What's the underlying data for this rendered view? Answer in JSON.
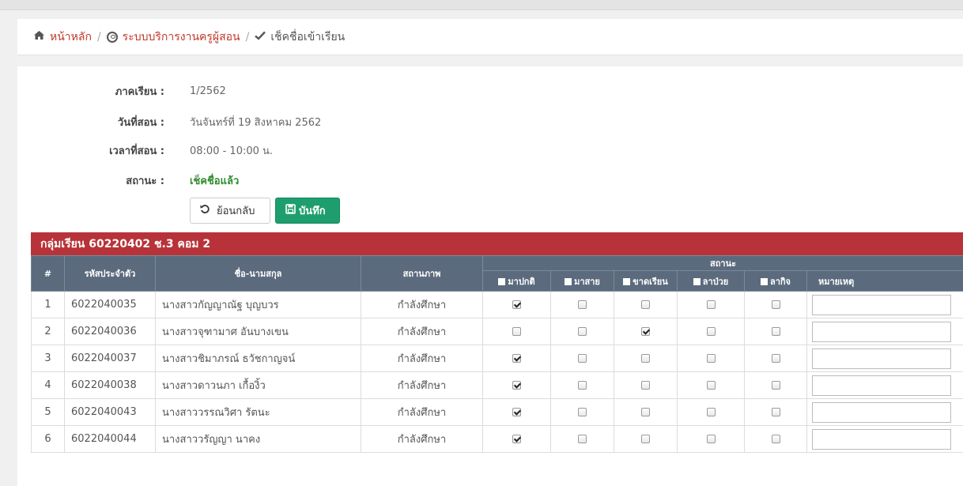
{
  "breadcrumb": {
    "home_label": "หน้าหลัก",
    "system_label": "ระบบบริการงานครูผู้สอน",
    "current_label": "เช็คชื่อเข้าเรียน",
    "separator": "/"
  },
  "info": {
    "term_label": "ภาคเรียน :",
    "term_value": "1/2562",
    "date_label": "วันที่สอน :",
    "date_value": "วันจันทร์ที่ 19 สิงหาคม 2562",
    "time_label": "เวลาที่สอน :",
    "time_value": "08:00 - 10:00 น.",
    "status_label": "สถานะ :",
    "status_value": "เช็คชื่อแล้ว",
    "status_color": "#2e8b2e"
  },
  "buttons": {
    "back_label": "ย้อนกลับ",
    "back_icon": "undo-icon",
    "save_label": "บันทึก",
    "save_icon": "floppy-disk-icon",
    "save_color": "#1e9e6e"
  },
  "group": {
    "title": "กลุ่มเรียน 60220402 ช.3 คอม 2",
    "color": "#b83339"
  },
  "table": {
    "headers": {
      "num": "#",
      "student_id": "รหัสประจำตัว",
      "name": "ชื่อ-นามสกุล",
      "standing": "สถานภาพ",
      "status_group": "สถานะ",
      "present": "มาปกติ",
      "late": "มาสาย",
      "absent": "ขาดเรียน",
      "sick_leave": "ลาป่วย",
      "personal_leave": "ลากิจ",
      "remark": "หมายเหตุ"
    },
    "header_color": "#5b6b7d",
    "rows": [
      {
        "num": "1",
        "student_id": "6022040035",
        "name": "นางสาวกัญญาณัฐ บุญบวร",
        "standing": "กำลังศึกษา",
        "checks": [
          true,
          false,
          false,
          false,
          false
        ],
        "remark": ""
      },
      {
        "num": "2",
        "student_id": "6022040036",
        "name": "นางสาวจุฑามาศ อันบางเขน",
        "standing": "กำลังศึกษา",
        "checks": [
          false,
          false,
          true,
          false,
          false
        ],
        "remark": ""
      },
      {
        "num": "3",
        "student_id": "6022040037",
        "name": "นางสาวชิมาภรณ์ ธวัชกาญจน์",
        "standing": "กำลังศึกษา",
        "checks": [
          true,
          false,
          false,
          false,
          false
        ],
        "remark": ""
      },
      {
        "num": "4",
        "student_id": "6022040038",
        "name": "นางสาวดาวนภา เกื้องิ้ว",
        "standing": "กำลังศึกษา",
        "checks": [
          true,
          false,
          false,
          false,
          false
        ],
        "remark": ""
      },
      {
        "num": "5",
        "student_id": "6022040043",
        "name": "นางสาววรรณวิศา รัตนะ",
        "standing": "กำลังศึกษา",
        "checks": [
          true,
          false,
          false,
          false,
          false
        ],
        "remark": ""
      },
      {
        "num": "6",
        "student_id": "6022040044",
        "name": "นางสาววรัญญา นาคง",
        "standing": "กำลังศึกษา",
        "checks": [
          true,
          false,
          false,
          false,
          false
        ],
        "remark": ""
      }
    ]
  }
}
